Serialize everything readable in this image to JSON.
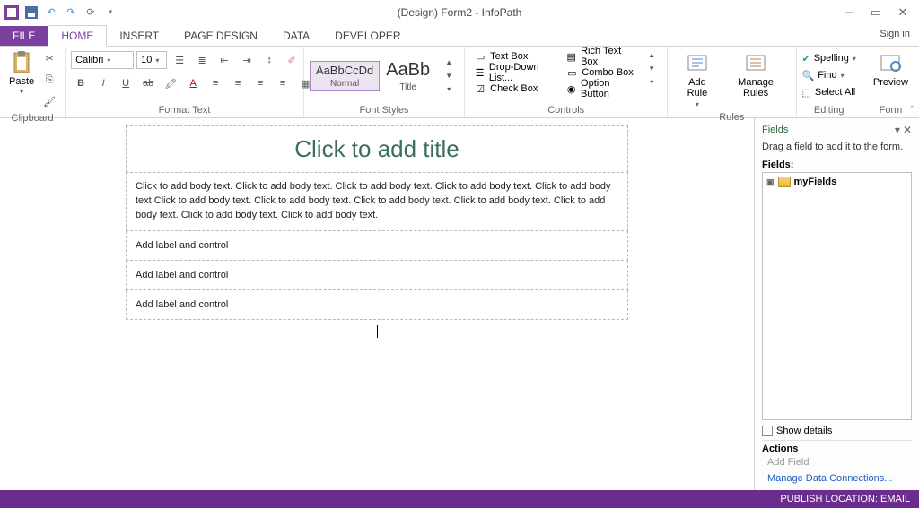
{
  "title": "(Design) Form2 - InfoPath",
  "signin": "Sign in",
  "tabs": {
    "file": "FILE",
    "home": "HOME",
    "insert": "INSERT",
    "page": "PAGE DESIGN",
    "data": "DATA",
    "dev": "DEVELOPER"
  },
  "ribbon": {
    "clipboard": {
      "paste": "Paste",
      "label": "Clipboard"
    },
    "format": {
      "font": "Calibri",
      "size": "10",
      "label": "Format Text"
    },
    "styles": {
      "normal_prev": "AaBbCcDd",
      "normal": "Normal",
      "title_prev": "AaBb",
      "title": "Title",
      "label": "Font Styles"
    },
    "controls": {
      "textbox": "Text Box",
      "rich": "Rich Text Box",
      "drop": "Drop-Down List...",
      "combo": "Combo Box",
      "check": "Check Box",
      "option": "Option Button",
      "label": "Controls"
    },
    "rules": {
      "add": "Add Rule",
      "manage": "Manage Rules",
      "label": "Rules"
    },
    "editing": {
      "spell": "Spelling",
      "find": "Find",
      "select": "Select All",
      "label": "Editing"
    },
    "form": {
      "preview": "Preview",
      "label": "Form"
    }
  },
  "canvas": {
    "title": "Click to add title",
    "body": "Click to add body text. Click to add body text. Click to add body text. Click to add body text. Click to add body text Click to add body text. Click to add body text. Click to add body text. Click to add body text. Click to add body text. Click to add body text. Click to add body text.",
    "row1": "Add label and control",
    "row2": "Add label and control",
    "row3": "Add label and control"
  },
  "side": {
    "title": "Fields",
    "hint": "Drag a field to add it to the form.",
    "fields_label": "Fields:",
    "root": "myFields",
    "show": "Show details",
    "actions": "Actions",
    "add": "Add Field",
    "manage": "Manage Data Connections..."
  },
  "status": "PUBLISH LOCATION: EMAIL"
}
